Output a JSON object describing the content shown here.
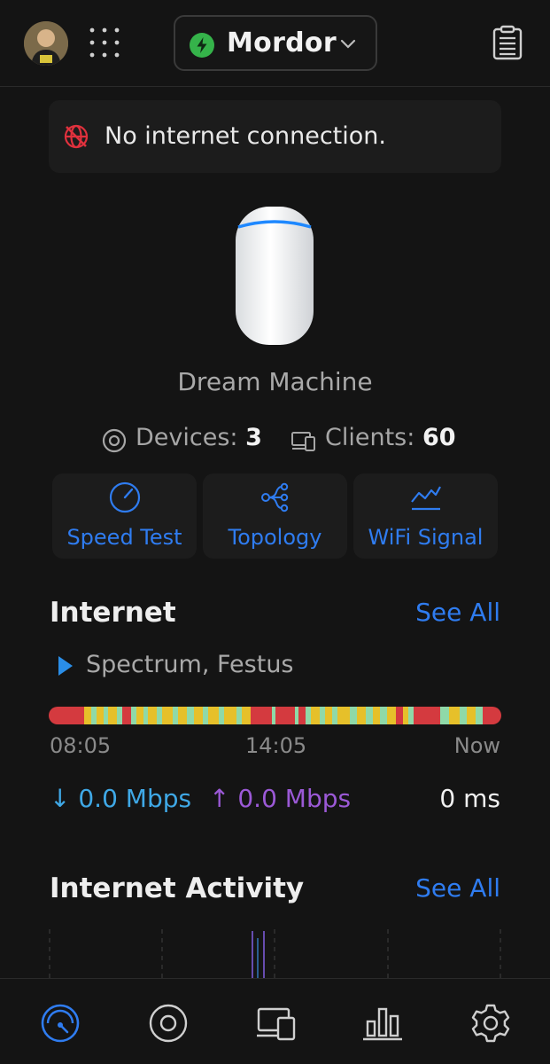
{
  "header": {
    "site_name": "Mordor",
    "icons": {
      "apps": "grid-icon",
      "notes": "notes-icon",
      "status": "bolt-icon",
      "dropdown": "chevron-down-icon"
    }
  },
  "alert": {
    "text": "No internet connection.",
    "icon": "globe-offline-icon",
    "color": "#e0313d"
  },
  "device": {
    "name": "Dream Machine"
  },
  "stats": {
    "devices_label": "Devices:",
    "devices_value": "3",
    "clients_label": "Clients:",
    "clients_value": "60"
  },
  "quick_actions": [
    {
      "label": "Speed Test",
      "icon": "speedometer-icon"
    },
    {
      "label": "Topology",
      "icon": "topology-icon"
    },
    {
      "label": "WiFi Signal",
      "icon": "signal-chart-icon"
    }
  ],
  "internet": {
    "title": "Internet",
    "see_all": "See All",
    "isp": "Spectrum, Festus",
    "timeline": {
      "start": "08:05",
      "mid": "14:05",
      "end": "Now"
    },
    "download": "↓ 0.0 Mbps",
    "upload": "↑ 0.0 Mbps",
    "latency": "0 ms",
    "colors": {
      "download": "#3fa8e6",
      "upload": "#9b59d6",
      "down": "#d43a3f",
      "degraded": "#e6c02a",
      "ok": "#8fd9a8"
    }
  },
  "activity": {
    "title": "Internet Activity",
    "see_all": "See All"
  },
  "bottom_nav": [
    {
      "name": "dashboard",
      "icon": "dashboard-icon",
      "active": true
    },
    {
      "name": "devices",
      "icon": "devices-icon",
      "active": false
    },
    {
      "name": "clients",
      "icon": "clients-icon",
      "active": false
    },
    {
      "name": "statistics",
      "icon": "statistics-icon",
      "active": false
    },
    {
      "name": "settings",
      "icon": "gear-icon",
      "active": false
    }
  ],
  "colors": {
    "accent": "#2f7cf0",
    "background": "#141414",
    "card": "#1c1c1c"
  }
}
